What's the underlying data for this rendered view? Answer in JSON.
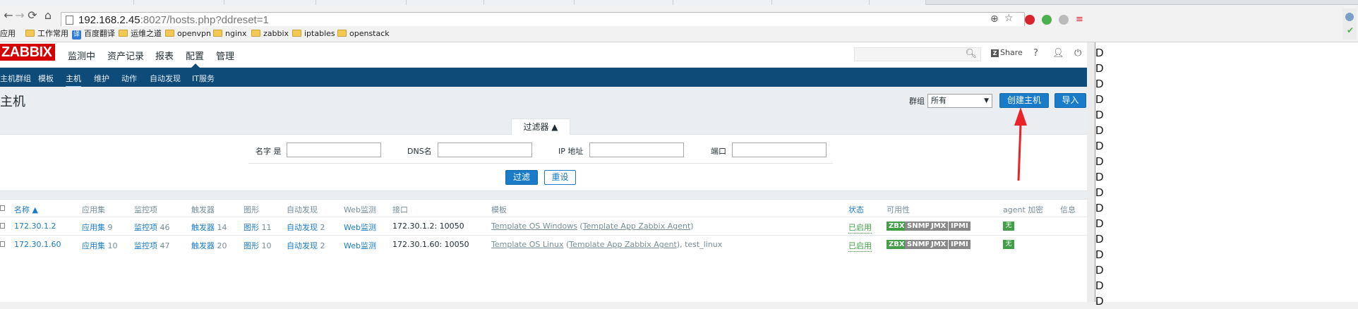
{
  "browser": {
    "url_host": "192.168.2.45",
    "url_rest": ":8027/hosts.php?ddreset=1",
    "bookmarks": [
      {
        "label": "应用",
        "icon": "apps-icon"
      },
      {
        "label": "工作常用",
        "icon": "folder-icon"
      },
      {
        "label": "百度翻译",
        "icon": "translate-icon"
      },
      {
        "label": "运维之道",
        "icon": "folder-icon"
      },
      {
        "label": "openvpn",
        "icon": "folder-icon"
      },
      {
        "label": "nginx",
        "icon": "folder-icon"
      },
      {
        "label": "zabbix",
        "icon": "folder-icon"
      },
      {
        "label": "iptables",
        "icon": "folder-icon"
      },
      {
        "label": "openstack",
        "icon": "folder-icon"
      }
    ],
    "translate_badge": "译"
  },
  "zabbix": {
    "logo": "ZABBIX",
    "main_menu": [
      "监测中",
      "资产记录",
      "报表",
      "配置",
      "管理"
    ],
    "share": "Share",
    "help": "?",
    "sub_menu": [
      "主机群组",
      "模板",
      "主机",
      "维护",
      "动作",
      "自动发现",
      "IT服务"
    ],
    "page_title": "主机",
    "group_label": "群组",
    "group_value": "所有",
    "create_host": "创建主机",
    "import": "导入",
    "filter": {
      "tab": "过滤器 ▲",
      "name_label": "名字 是",
      "dns_label": "DNS名",
      "ip_label": "IP 地址",
      "port_label": "端口",
      "apply": "过滤",
      "reset": "重设"
    },
    "table": {
      "headers": [
        "名称 ▲",
        "应用集",
        "监控项",
        "触发器",
        "图形",
        "自动发现",
        "Web监测",
        "接口",
        "模板",
        "状态",
        "可用性",
        "agent 加密",
        "信息"
      ],
      "rows": [
        {
          "name": "172.30.1.2",
          "apps": "应用集",
          "apps_n": "9",
          "items": "监控项",
          "items_n": "46",
          "triggers": "触发器",
          "triggers_n": "14",
          "graphs": "图形",
          "graphs_n": "11",
          "discovery": "自动发现",
          "discovery_n": "2",
          "web": "Web监测",
          "interface": "172.30.1.2: 10050",
          "template": "Template OS Windows",
          "template_paren_open": " (",
          "template_sub": "Template App Zabbix Agent",
          "template_tail": ")",
          "status": "已启用",
          "avail": [
            "ZBX",
            "SNMP",
            "JMX",
            "IPMI"
          ],
          "encryption": "无"
        },
        {
          "name": "172.30.1.60",
          "apps": "应用集",
          "apps_n": "10",
          "items": "监控项",
          "items_n": "47",
          "triggers": "触发器",
          "triggers_n": "20",
          "graphs": "图形",
          "graphs_n": "10",
          "discovery": "自动发现",
          "discovery_n": "2",
          "web": "Web监测",
          "interface": "172.30.1.60: 10050",
          "template": "Template OS Linux",
          "template_paren_open": " (",
          "template_sub": "Template App Zabbix Agent",
          "template_tail": "), test_linux",
          "status": "已启用",
          "avail": [
            "ZBX",
            "SNMP",
            "JMX",
            "IPMI"
          ],
          "encryption": "无"
        }
      ]
    }
  },
  "side_panel": {
    "letters": [
      "D",
      "D",
      "D",
      "D",
      "D",
      "D",
      "D",
      "D",
      "D",
      "D",
      "D",
      "D",
      "D",
      "D",
      "D",
      "D",
      "D"
    ]
  },
  "colors": {
    "brand_red": "#d40000",
    "subnav_blue": "#0e4b78",
    "link_blue": "#1a7bc8",
    "status_green": "#429e47",
    "annotation_red": "#e8232a"
  }
}
